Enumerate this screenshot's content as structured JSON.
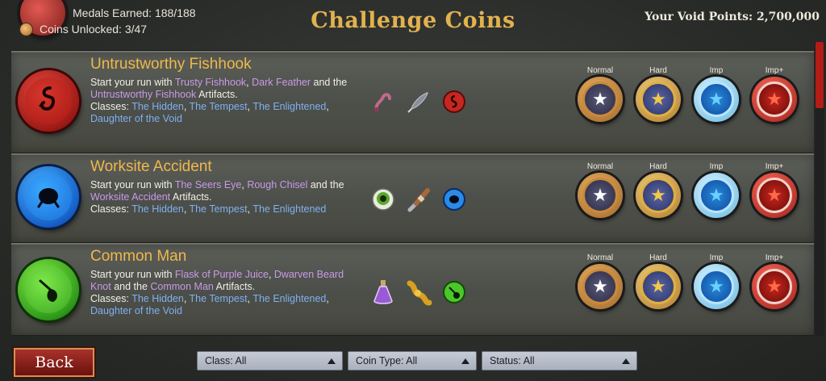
{
  "header": {
    "medals_earned": "Medals Earned: 188/188",
    "coins_unlocked": "Coins Unlocked: 3/47",
    "title": "Challenge Coins",
    "void_points": "Your Void Points: 2,700,000"
  },
  "difficulty_labels": [
    "Normal",
    "Hard",
    "Imp",
    "Imp+"
  ],
  "coins": [
    {
      "name": "Untrustworthy Fishhook",
      "color": "red",
      "desc": {
        "prefix": "Start your run with ",
        "a1": "Trusty Fishhook",
        "sep1": ", ",
        "a2": "Dark Feather",
        "sep2": " and the ",
        "a3": "Untrustworthy Fishhook",
        "suffix": " Artifacts."
      },
      "classes_label": "Classes: ",
      "classes": [
        "The Hidden",
        "The Tempest",
        "The Enlightened",
        "Daughter of the Void"
      ],
      "items": [
        "fishhook-icon",
        "feather-icon",
        "red-coin-icon"
      ]
    },
    {
      "name": "Worksite Accident",
      "color": "blue",
      "desc": {
        "prefix": "Start your run with ",
        "a1": "The Seers Eye",
        "sep1": ", ",
        "a2": "Rough Chisel",
        "sep2": " and the ",
        "a3": "Worksite Accident",
        "suffix": " Artifacts."
      },
      "classes_label": "Classes: ",
      "classes": [
        "The Hidden",
        "The Tempest",
        "The Enlightened"
      ],
      "items": [
        "eye-icon",
        "chisel-icon",
        "blue-coin-icon"
      ]
    },
    {
      "name": "Common Man",
      "color": "green",
      "desc": {
        "prefix": "Start your run with ",
        "a1": "Flask of Purple Juice",
        "sep1": ", ",
        "a2": "Dwarven Beard Knot",
        "sep2": " and the ",
        "a3": "Common Man",
        "suffix": " Artifacts."
      },
      "classes_label": "Classes: ",
      "classes": [
        "The Hidden",
        "The Tempest",
        "The Enlightened",
        "Daughter of the Void"
      ],
      "items": [
        "flask-icon",
        "beard-knot-icon",
        "green-coin-icon"
      ]
    }
  ],
  "footer": {
    "back_label": "Back",
    "class_filter": "Class: All",
    "coin_type_filter": "Coin Type: All",
    "status_filter": "Status: All"
  },
  "colors": {
    "title_gold": "#e2b24e",
    "artifact_purple": "#c89ae8",
    "class_blue": "#7fb0f0"
  }
}
